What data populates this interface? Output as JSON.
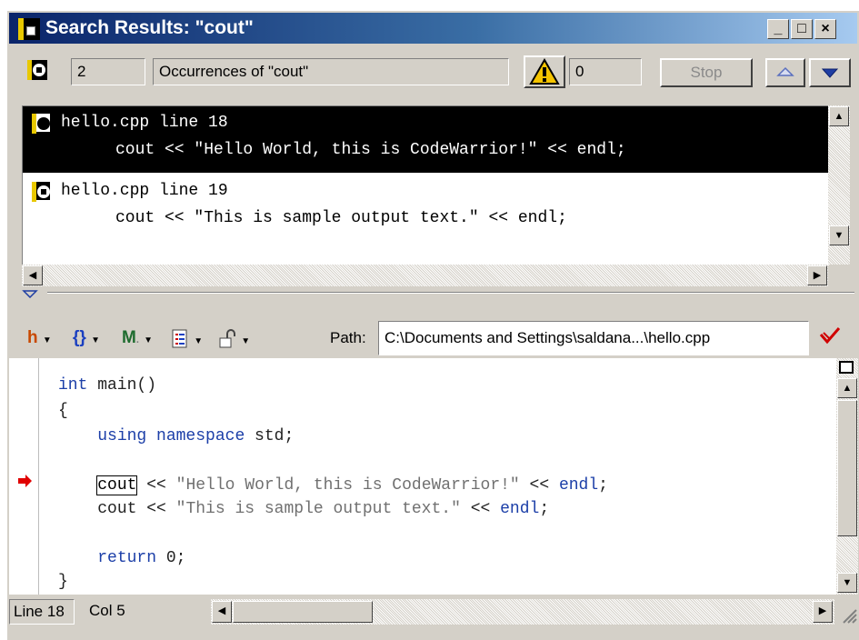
{
  "window": {
    "title": "Search Results: \"cout\""
  },
  "title_buttons": [
    "_",
    "□",
    "×"
  ],
  "toolbar": {
    "count": "2",
    "occurrences_label": "Occurrences of \"cout\"",
    "warnings_count": "0",
    "stop_label": "Stop"
  },
  "results": [
    {
      "file_line": "hello.cpp line 18",
      "code": "cout << \"Hello World, this is CodeWarrior!\" << endl;",
      "selected": true
    },
    {
      "file_line": "hello.cpp line 19",
      "code": "cout << \"This is sample output text.\" << endl;",
      "selected": false
    }
  ],
  "editor_toolbar": {
    "path_label": "Path:",
    "path_value": "C:\\Documents and Settings\\saldana...\\hello.cpp"
  },
  "code_lines": [
    "int main()",
    "{",
    "    using namespace std;",
    "",
    "    cout << \"Hello World, this is CodeWarrior!\" << endl;",
    "    cout << \"This is sample output text.\" << endl;",
    "",
    "    return 0;",
    "}"
  ],
  "code_tokens": {
    "l0_kw": "int",
    "l0_rest": " main()",
    "l1": "{",
    "l2_kw": "using namespace",
    "l2_rest": " std;",
    "l4_a": "cout",
    "l4_b": " << ",
    "l4_str": "\"Hello World, this is CodeWarrior!\"",
    "l4_c": " << ",
    "l4_kw": "endl",
    "l4_d": ";",
    "l5_a": "cout << ",
    "l5_str": "\"This is sample output text.\"",
    "l5_c": " << ",
    "l5_kw": "endl",
    "l5_d": ";",
    "l7_kw": "return",
    "l7_rest": " 0;",
    "l8": "}"
  },
  "status": {
    "line": "Line 18",
    "col": "Col 5"
  },
  "colors": {
    "title_start": "#0a246a",
    "title_end": "#a6caf0",
    "breakpoint_arrow": "#e00000",
    "keyword": "#1c3fa8"
  }
}
